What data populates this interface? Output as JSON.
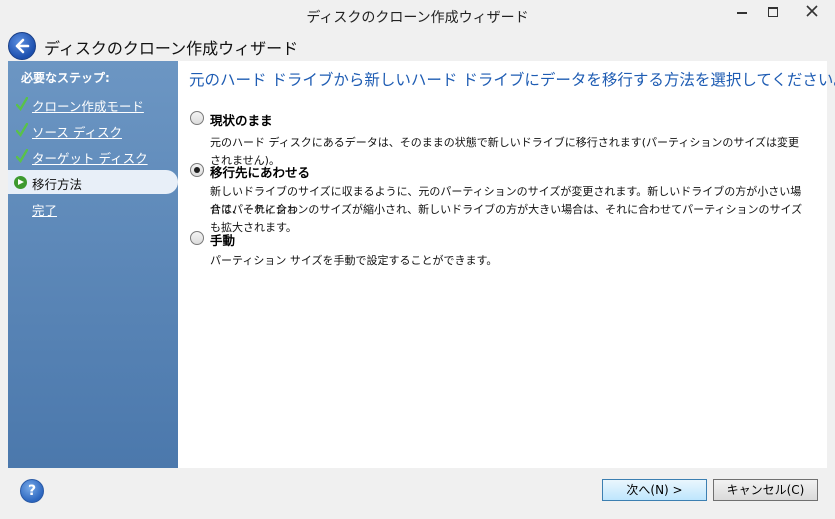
{
  "window": {
    "title": "ディスクのクローン作成ウィザード"
  },
  "header": {
    "title": "ディスクのクローン作成ウィザード"
  },
  "sidebar": {
    "title": "必要なステップ:",
    "steps": [
      {
        "label": "クローン作成モード",
        "status": "done"
      },
      {
        "label": "ソース ディスク",
        "status": "done"
      },
      {
        "label": "ターゲット ディスク",
        "status": "done"
      },
      {
        "label": "移行方法",
        "status": "current"
      },
      {
        "label": "完了",
        "status": "pending"
      }
    ]
  },
  "main": {
    "heading": "元のハード ドライブから新しいハード ドライブにデータを移行する方法を選択してください。",
    "options": [
      {
        "label": "現状のまま",
        "selected": false,
        "description": "元のハード ディスクにあるデータは、そのままの状態で新しいドライブに移行されます(パーティションのサイズは変更されません)。"
      },
      {
        "label": "移行先にあわせる",
        "selected": true,
        "description_line1": "新しいドライブのサイズに収まるように、元のパーティションのサイズが変更されます。新しいドライブの方が小さい場合は、それに合わ",
        "description_line2": "せてパーティションのサイズが縮小され、新しいドライブの方が大きい場合は、それに合わせてパーティションのサイズも拡大されます。"
      },
      {
        "label": "手動",
        "selected": false,
        "description": "パーティション サイズを手動で設定することができます。"
      }
    ]
  },
  "footer": {
    "help_label": "?",
    "next_label": "次へ(N) >",
    "cancel_label": "キャンセル(C)"
  },
  "colors": {
    "accent": "#1e5cb3",
    "sidebar_top": "#6c96c3",
    "sidebar_bottom": "#4b78ac",
    "check": "#3e9a2f"
  }
}
